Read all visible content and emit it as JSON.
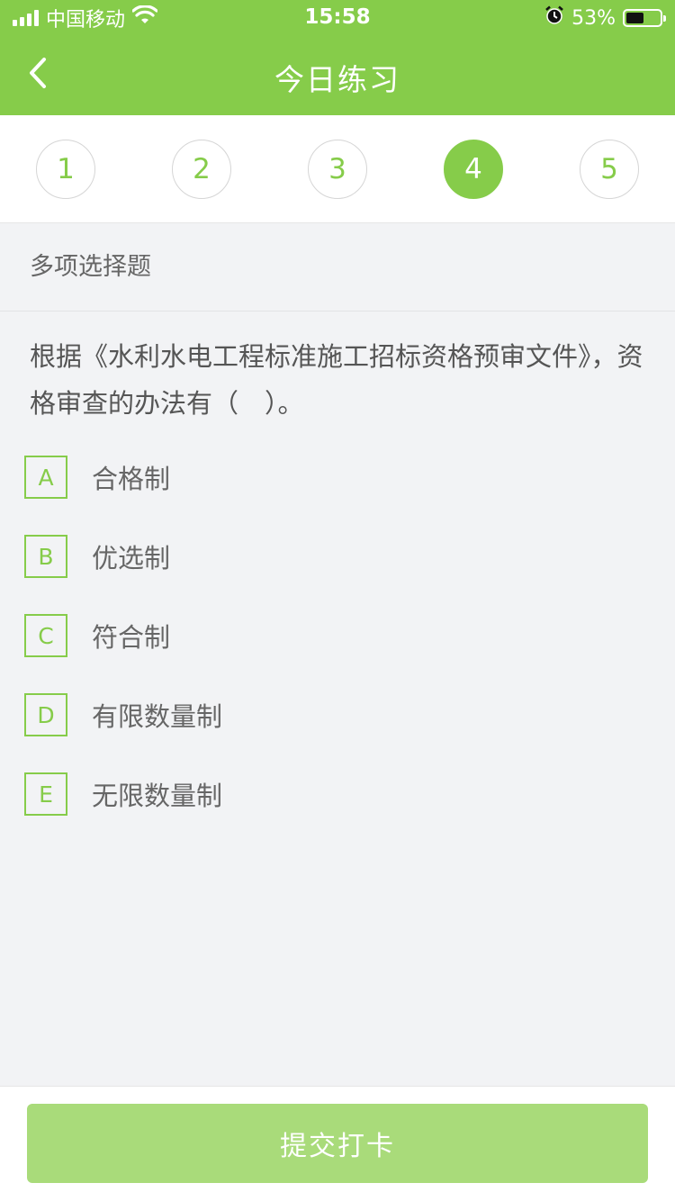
{
  "status_bar": {
    "carrier": "中国移动",
    "time": "15:58",
    "battery_percent": "53%",
    "battery_level": 0.53,
    "icons": [
      "signal-icon",
      "wifi-icon",
      "alarm-icon",
      "battery-icon"
    ]
  },
  "nav": {
    "title": "今日练习",
    "back_icon": "chevron-left-icon"
  },
  "question_tabs": {
    "items": [
      "1",
      "2",
      "3",
      "4",
      "5"
    ],
    "active_index": 3
  },
  "question": {
    "type": "多项选择题",
    "text": "根据《水利水电工程标准施工招标资格预审文件》，资格审查的办法有（　）。",
    "options": [
      {
        "key": "A",
        "text": "合格制"
      },
      {
        "key": "B",
        "text": "优选制"
      },
      {
        "key": "C",
        "text": "符合制"
      },
      {
        "key": "D",
        "text": "有限数量制"
      },
      {
        "key": "E",
        "text": "无限数量制"
      }
    ]
  },
  "footer": {
    "submit_label": "提交打卡"
  },
  "colors": {
    "brand_green": "#86cc4a",
    "submit_disabled": "#a9db7a",
    "background": "#f2f3f5"
  }
}
